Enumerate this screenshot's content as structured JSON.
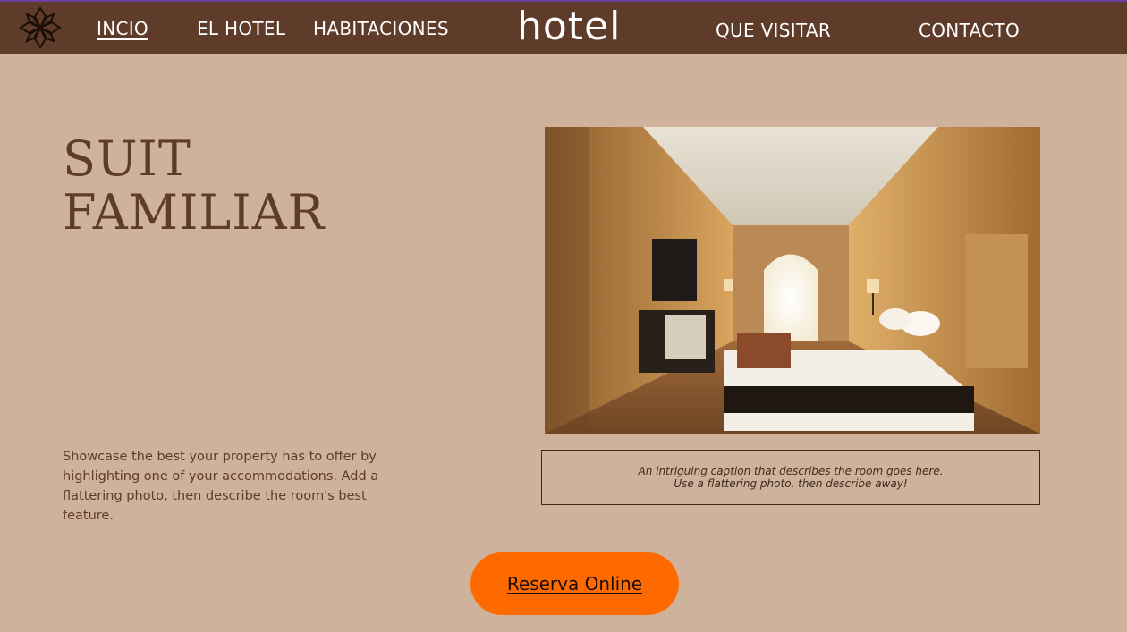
{
  "nav": {
    "items": [
      {
        "label": "INCIO",
        "active": true
      },
      {
        "label": "EL HOTEL",
        "active": false
      },
      {
        "label": "HABITACIONES",
        "active": false
      },
      {
        "label": "QUE VISITAR",
        "active": false
      },
      {
        "label": "CONTACTO",
        "active": false
      }
    ],
    "brand": "hotel",
    "logo_icon": "ornamental-flower-icon"
  },
  "hero": {
    "title_line1": "SUIT",
    "title_line2": "FAMILIAR",
    "description": "Showcase the best your property has to offer by highlighting one of your accommodations. Add a flattering photo, then describe the room's best feature.",
    "photo_subject": "hotel-room-photo",
    "caption_line1": "An intriguing caption that describes the room goes here.",
    "caption_line2": "Use a flattering photo, then describe away!"
  },
  "cta": {
    "label": "Reserva Online"
  },
  "colors": {
    "nav_bg": "#5f3b2a",
    "page_bg": "#cfb29b",
    "accent": "#ff6a00",
    "text_brown": "#5f3b2a"
  }
}
